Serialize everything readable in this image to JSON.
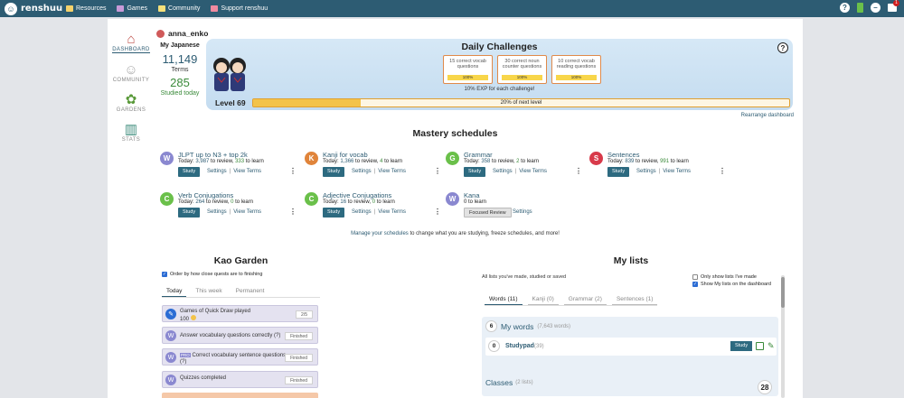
{
  "topbar": {
    "app": "renshuu",
    "nav": [
      "Resources",
      "Games",
      "Community",
      "Support renshuu"
    ],
    "badge": "1"
  },
  "side": [
    {
      "label": "Dashboard",
      "icon": "house"
    },
    {
      "label": "Community",
      "icon": "people"
    },
    {
      "label": "Gardens",
      "icon": "sprout"
    },
    {
      "label": "Stats",
      "icon": "bar-chart"
    }
  ],
  "user": {
    "name": "anna_enko"
  },
  "stats": {
    "header": "My Japanese",
    "terms": "11,149",
    "terms_label": "Terms",
    "studied": "285",
    "studied_label": "Studied today"
  },
  "daily": {
    "title": "Daily Challenges",
    "challenges": [
      {
        "text": "15 correct vocab questions",
        "progress": "100%"
      },
      {
        "text": "30 correct noun counter questions",
        "progress": "100%"
      },
      {
        "text": "10 correct vocab reading questions",
        "progress": "100%"
      }
    ],
    "note": "10% EXP for each challenge!",
    "level": "Level 69",
    "level_progress": "20% of next level",
    "level_fraction": 0.2
  },
  "rearrange": "Rearrange dashboard",
  "mastery_title": "Mastery schedules",
  "schedules": [
    {
      "badge": "W",
      "color": "#8a88d0",
      "name": "JLPT up to N3 + top 2k",
      "review": "3,987",
      "learn": "333",
      "btn": "Study"
    },
    {
      "badge": "K",
      "color": "#e0843a",
      "name": "Kanji for vocab",
      "review": "1,366",
      "learn": "4",
      "btn": "Study"
    },
    {
      "badge": "G",
      "color": "#6ac04a",
      "name": "Grammar",
      "review": "358",
      "learn": "2",
      "btn": "Study"
    },
    {
      "badge": "S",
      "color": "#d83a4a",
      "name": "Sentences",
      "review": "839",
      "learn": "991",
      "btn": "Study"
    },
    {
      "badge": "C",
      "color": "#6ac04a",
      "name": "Verb Conjugations",
      "review": "264",
      "learn": "0",
      "btn": "Study"
    },
    {
      "badge": "C",
      "color": "#6ac04a",
      "name": "Adjective Conjugations",
      "review": "16",
      "learn": "0",
      "btn": "Study"
    },
    {
      "badge": "W",
      "color": "#8a88d0",
      "name": "Kana",
      "line": "0 to learn",
      "btn": "Focused Review"
    }
  ],
  "labels": {
    "today": "Today:",
    "to_review": "to review,",
    "to_learn": "to learn",
    "settings": "Settings",
    "view_terms": "View Terms",
    "sep": "|"
  },
  "manage": {
    "link": "Manage your schedules",
    "rest": "to change what you are studying, freeze schedules, and more!"
  },
  "garden": {
    "title": "Kao Garden",
    "order_label": "Order by how close quests are to finishing",
    "tabs": [
      "Today",
      "This week",
      "Permanent"
    ],
    "quests": [
      {
        "text": "Games of Quick Draw played",
        "sub": "100",
        "status": "2/5"
      },
      {
        "text": "Answer vocabulary questions correctly (?)",
        "status": "Finished"
      },
      {
        "text": "Correct vocabulary sentence questions (?)",
        "tag": "PRO",
        "status": "Finished"
      },
      {
        "text": "Quizzes completed",
        "status": "Finished"
      }
    ]
  },
  "lists": {
    "title": "My lists",
    "desc": "All lists you've made, studied or saved",
    "opt1": "Only show lists I've made",
    "opt2": "Show My lists on the dashboard",
    "tabs": [
      "Words (11)",
      "Kanji (0)",
      "Grammar (2)",
      "Sentences (1)"
    ],
    "mywords": {
      "count": "6",
      "title": "My words",
      "sub": "(7,643 words)"
    },
    "studypad": {
      "count": "0",
      "title": "Studypad",
      "sub": "(39)",
      "btn": "Study"
    },
    "classes": {
      "title": "Classes",
      "sub": "(2 lists)",
      "count": "28"
    }
  }
}
